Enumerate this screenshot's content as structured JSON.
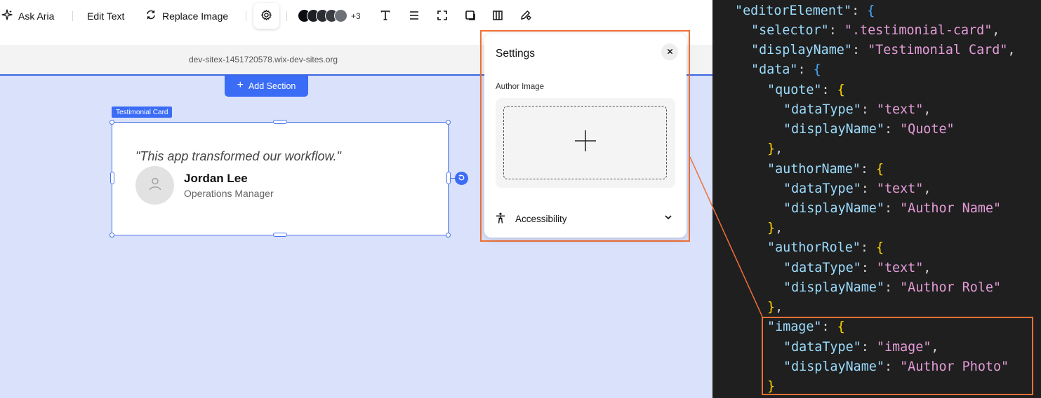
{
  "toolbar": {
    "ask_aria": "Ask Aria",
    "edit_text": "Edit Text",
    "replace_image": "Replace Image",
    "swatch_more": "+3",
    "swatch_colors": [
      "#0b0c10",
      "#1d1f25",
      "#2b2d33",
      "#3a3c43",
      "#6e7077"
    ]
  },
  "site": {
    "url": "dev-sitex-1451720578.wix-dev-sites.org",
    "add_section": "Add Section"
  },
  "card": {
    "tag": "Testimonial Card",
    "quote": "\"This app transformed our workflow.\"",
    "author_name": "Jordan Lee",
    "author_role": "Operations Manager"
  },
  "settings": {
    "title": "Settings",
    "author_image_label": "Author Image",
    "accessibility_label": "Accessibility"
  },
  "code": {
    "line1_key": "\"editorElement\"",
    "line2_key": "\"selector\"",
    "line2_val": "\".testimonial-card\"",
    "line3_key": "\"displayName\"",
    "line3_val": "\"Testimonial Card\"",
    "line4_key": "\"data\"",
    "quote_key": "\"quote\"",
    "datatype_key": "\"dataType\"",
    "displayname_key": "\"displayName\"",
    "text_val": "\"text\"",
    "quote_name": "\"Quote\"",
    "authorname_key": "\"authorName\"",
    "authorname_name": "\"Author Name\"",
    "authorrole_key": "\"authorRole\"",
    "authorrole_name": "\"Author Role\"",
    "image_key": "\"image\"",
    "image_val": "\"image\"",
    "image_name": "\"Author Photo\""
  },
  "colors": {
    "accent": "#3b6cf6",
    "highlight": "#f07036",
    "canvas": "#d9e1fb"
  }
}
